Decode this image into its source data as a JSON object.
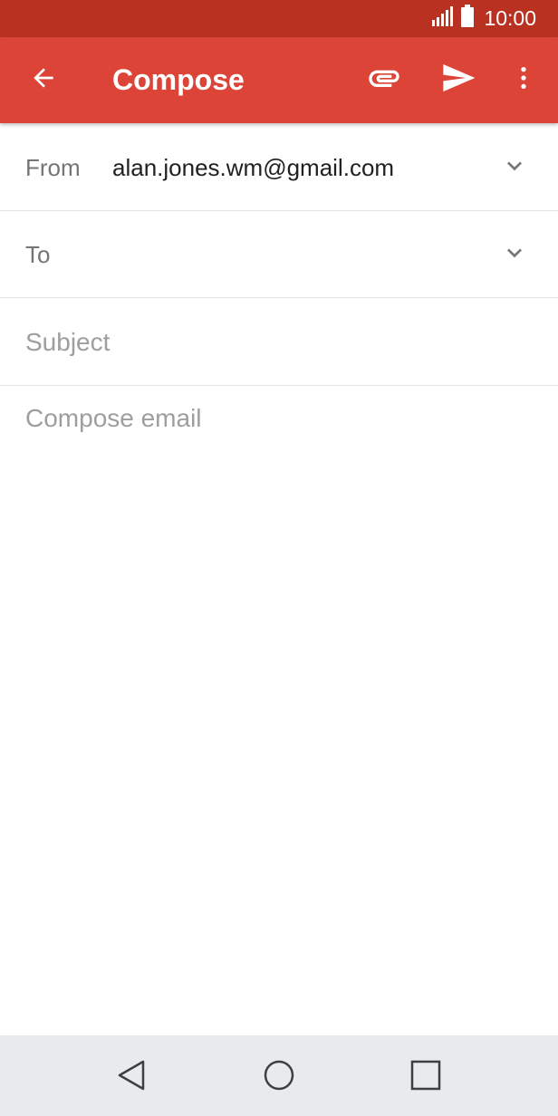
{
  "status_bar": {
    "time": "10:00",
    "signal_icon": "signal-icon",
    "battery_icon": "battery-icon"
  },
  "app_bar": {
    "title": "Compose",
    "back_icon": "arrow-back-icon",
    "attach_icon": "paperclip-icon",
    "send_icon": "send-icon",
    "more_icon": "more-vert-icon"
  },
  "form": {
    "from_label": "From",
    "from_value": "alan.jones.wm@gmail.com",
    "to_label": "To",
    "to_value": "",
    "subject_placeholder": "Subject",
    "subject_value": "",
    "body_placeholder": "Compose email",
    "body_value": ""
  },
  "nav_bar": {
    "back_icon": "nav-back-triangle-icon",
    "home_icon": "nav-home-circle-icon",
    "recent_icon": "nav-recent-square-icon"
  },
  "colors": {
    "status_bar": "#b93221",
    "app_bar": "#db4437",
    "nav_bar": "#e8eaee",
    "label_text": "#757575",
    "value_text": "#212121",
    "placeholder_text": "#9e9e9e"
  }
}
